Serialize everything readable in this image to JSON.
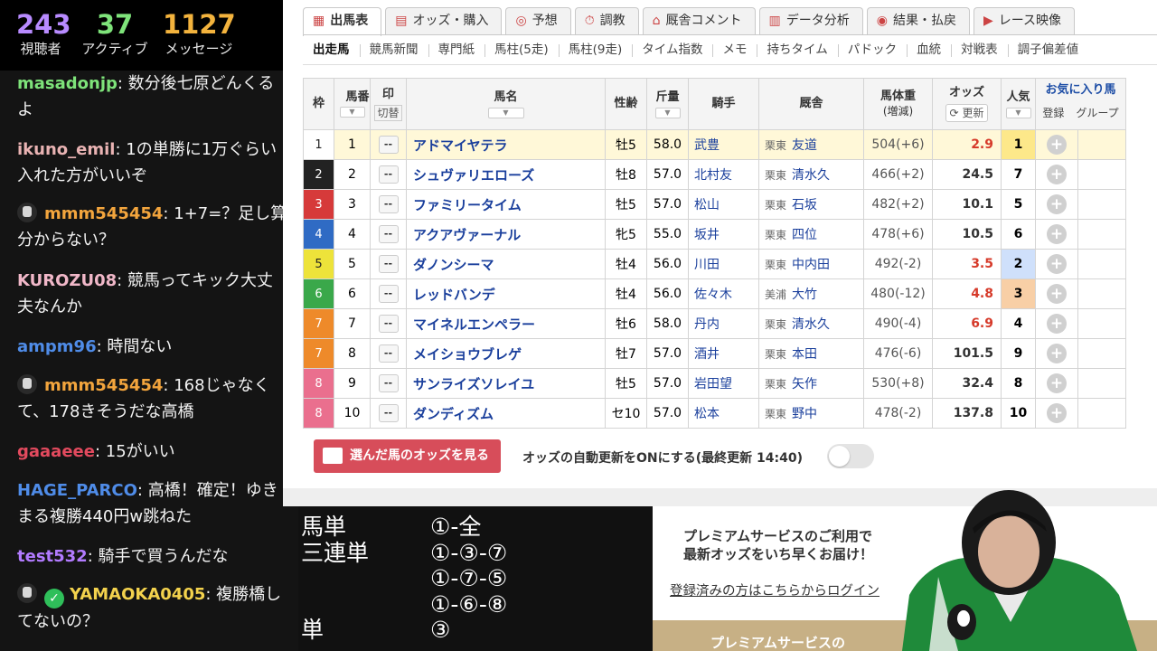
{
  "stats": [
    {
      "value": "243",
      "label": "視聴者",
      "color": "#b88bff"
    },
    {
      "value": "37",
      "label": "アクティブ",
      "color": "#7ee37a"
    },
    {
      "value": "1127",
      "label": "メッセージ",
      "color": "#f3b33d"
    }
  ],
  "chat": [
    {
      "user": "masadonjp",
      "text": ": 数分後七原どんくるよ",
      "color": "#7ee37a",
      "badge": ""
    },
    {
      "user": "ikuno_emil",
      "text": ": 1の単勝に1万ぐらい入れた方がいいぞ",
      "color": "#e9b3b3",
      "badge": ""
    },
    {
      "user": "mmm545454",
      "text": ": 1+7=？足し算分からない？",
      "color": "#f3a53d",
      "badge": "mod"
    },
    {
      "user": "KUROZU08",
      "text": ": 競馬ってキック大丈夫なんか",
      "color": "#f0b7c8",
      "badge": ""
    },
    {
      "user": "ampm96",
      "text": ": 時間ない",
      "color": "#4f8ce8",
      "badge": ""
    },
    {
      "user": "mmm545454",
      "text": ": 168じゃなくて、178きそうだな高橋",
      "color": "#f3a53d",
      "badge": "mod"
    },
    {
      "user": "gaaaeee",
      "text": ": 15がいい",
      "color": "#e34a5e",
      "badge": ""
    },
    {
      "user": "HAGE_PARCO",
      "text": ": 高橋！確定！ゆきまる複勝440円w跳ねた",
      "color": "#4f8ce8",
      "badge": ""
    },
    {
      "user": "test532",
      "text": ": 騎手で買うんだな",
      "color": "#b27bff",
      "badge": ""
    },
    {
      "user": "YAMAOKA0405",
      "text": ": 複勝橋してないの？",
      "color": "#f3d24d",
      "badge": "mod-verified"
    }
  ],
  "tabs": [
    {
      "label": "出馬表",
      "icon": "table-icon",
      "glyph": "▦",
      "active": true
    },
    {
      "label": "オッズ・購入",
      "icon": "odds-icon",
      "glyph": "▤",
      "active": false
    },
    {
      "label": "予想",
      "icon": "target-icon",
      "glyph": "◎",
      "active": false
    },
    {
      "label": "調教",
      "icon": "stopwatch-icon",
      "glyph": "⏱",
      "active": false
    },
    {
      "label": "厩舎コメント",
      "icon": "stable-icon",
      "glyph": "⌂",
      "active": false
    },
    {
      "label": "データ分析",
      "icon": "bar-chart-icon",
      "glyph": "▥",
      "active": false
    },
    {
      "label": "結果・払戻",
      "icon": "coins-icon",
      "glyph": "◉",
      "active": false
    },
    {
      "label": "レース映像",
      "icon": "video-icon",
      "glyph": "▶",
      "active": false
    }
  ],
  "subnav": [
    "出走馬",
    "競馬新聞",
    "専門紙",
    "馬柱(5走)",
    "馬柱(9走)",
    "タイム指数",
    "メモ",
    "持ちタイム",
    "パドック",
    "血統",
    "対戦表",
    "調子偏差値"
  ],
  "table": {
    "headers": {
      "waku": "枠",
      "umaban": "馬番",
      "mark": "印",
      "mark_sub": "切替",
      "name": "馬名",
      "sexage": "性齢",
      "kinryo": "斤量",
      "jockey": "騎手",
      "trainer": "厩舎",
      "weight": "馬体重",
      "weight_sub": "(増減)",
      "odds": "オッズ",
      "odds_sub": "更新",
      "pop": "人気",
      "fav": "お気に入り馬",
      "fav_reg": "登録",
      "fav_group": "グループ"
    },
    "rows": [
      {
        "waku": "1",
        "umaban": "1",
        "mark": "--",
        "name": "アドマイヤテラ",
        "sexage": "牡5",
        "kinryo": "58.0",
        "jockey": "武豊",
        "loc": "栗東",
        "trainer": "友道",
        "weight": "504(+6)",
        "odds": "2.9",
        "pop": "1"
      },
      {
        "waku": "2",
        "umaban": "2",
        "mark": "--",
        "name": "シュヴァリエローズ",
        "sexage": "牡8",
        "kinryo": "57.0",
        "jockey": "北村友",
        "loc": "栗東",
        "trainer": "清水久",
        "weight": "466(+2)",
        "odds": "24.5",
        "pop": "7"
      },
      {
        "waku": "3",
        "umaban": "3",
        "mark": "--",
        "name": "ファミリータイム",
        "sexage": "牡5",
        "kinryo": "57.0",
        "jockey": "松山",
        "loc": "栗東",
        "trainer": "石坂",
        "weight": "482(+2)",
        "odds": "10.1",
        "pop": "5"
      },
      {
        "waku": "4",
        "umaban": "4",
        "mark": "--",
        "name": "アクアヴァーナル",
        "sexage": "牝5",
        "kinryo": "55.0",
        "jockey": "坂井",
        "loc": "栗東",
        "trainer": "四位",
        "weight": "478(+6)",
        "odds": "10.5",
        "pop": "6"
      },
      {
        "waku": "5",
        "umaban": "5",
        "mark": "--",
        "name": "ダノンシーマ",
        "sexage": "牡4",
        "kinryo": "56.0",
        "jockey": "川田",
        "loc": "栗東",
        "trainer": "中内田",
        "weight": "492(-2)",
        "odds": "3.5",
        "pop": "2"
      },
      {
        "waku": "6",
        "umaban": "6",
        "mark": "--",
        "name": "レッドバンデ",
        "sexage": "牡4",
        "kinryo": "56.0",
        "jockey": "佐々木",
        "loc": "美浦",
        "trainer": "大竹",
        "weight": "480(-12)",
        "odds": "4.8",
        "pop": "3"
      },
      {
        "waku": "7",
        "umaban": "7",
        "mark": "--",
        "name": "マイネルエンペラー",
        "sexage": "牡6",
        "kinryo": "58.0",
        "jockey": "丹内",
        "loc": "栗東",
        "trainer": "清水久",
        "weight": "490(-4)",
        "odds": "6.9",
        "pop": "4"
      },
      {
        "waku": "7",
        "umaban": "8",
        "mark": "--",
        "name": "メイショウブレゲ",
        "sexage": "牡7",
        "kinryo": "57.0",
        "jockey": "酒井",
        "loc": "栗東",
        "trainer": "本田",
        "weight": "476(-6)",
        "odds": "101.5",
        "pop": "9"
      },
      {
        "waku": "8",
        "umaban": "9",
        "mark": "--",
        "name": "サンライズソレイユ",
        "sexage": "牡5",
        "kinryo": "57.0",
        "jockey": "岩田望",
        "loc": "栗東",
        "trainer": "矢作",
        "weight": "530(+8)",
        "odds": "32.4",
        "pop": "8"
      },
      {
        "waku": "8",
        "umaban": "10",
        "mark": "--",
        "name": "ダンディズム",
        "sexage": "セ10",
        "kinryo": "57.0",
        "jockey": "松本",
        "loc": "栗東",
        "trainer": "野中",
        "weight": "478(-2)",
        "odds": "137.8",
        "pop": "10"
      }
    ]
  },
  "waku_colors": {
    "1": "#ffffff",
    "2": "#222222",
    "3": "#d63a3a",
    "4": "#2f6bc4",
    "5": "#ede33a",
    "6": "#3aa84a",
    "7": "#ee8a2a",
    "8": "#ea6f8e"
  },
  "pop_colors": {
    "1": "#fde88a",
    "2": "#cfe0fb",
    "3": "#f8cfa6"
  },
  "odds_bar": {
    "button": "選んだ馬のオッズを見る",
    "auto_update": "オッズの自動更新をONにする(最終更新 14:40)",
    "toggle_on": false
  },
  "bets": [
    {
      "label": "馬単",
      "value": "①-全"
    },
    {
      "label": "三連単",
      "value": "①-③-⑦"
    },
    {
      "label": "",
      "value": "①-⑦-⑤"
    },
    {
      "label": "",
      "value": "①-⑥-⑧"
    },
    {
      "label": "単",
      "value": "③"
    }
  ],
  "premium": {
    "line1": "プレミアムサービスのご利用で",
    "line2": "最新オッズをいち早くお届け！",
    "link": "登録済みの方はこちらからログイン",
    "band": "プレミアムサービスの"
  }
}
